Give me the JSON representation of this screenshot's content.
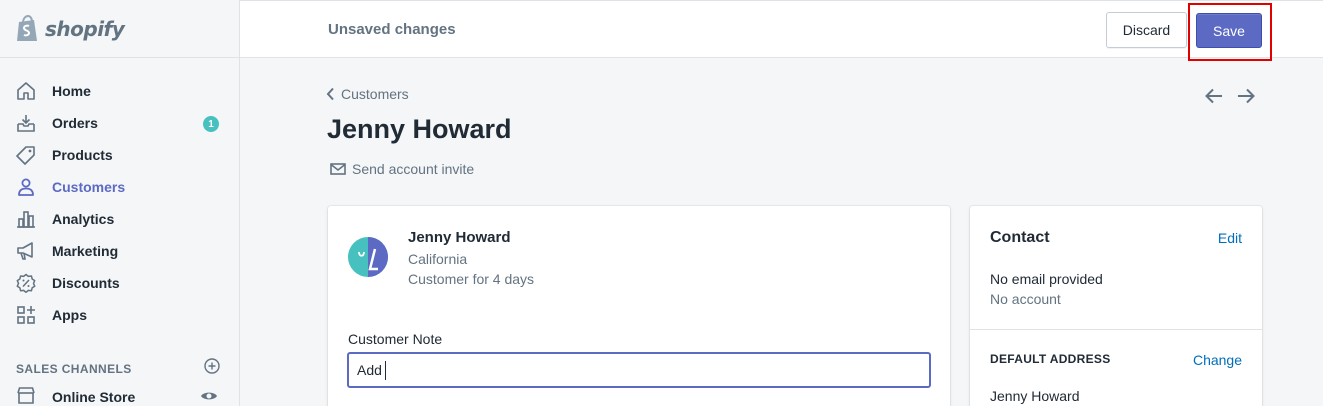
{
  "brand": {
    "name": "shopify",
    "icon": "shopify-bag-icon"
  },
  "sidebar": {
    "items": [
      {
        "label": "Home",
        "icon": "home-icon"
      },
      {
        "label": "Orders",
        "icon": "orders-icon",
        "badge": "1"
      },
      {
        "label": "Products",
        "icon": "tag-icon"
      },
      {
        "label": "Customers",
        "icon": "person-icon",
        "active": true
      },
      {
        "label": "Analytics",
        "icon": "bar-chart-icon"
      },
      {
        "label": "Marketing",
        "icon": "megaphone-icon"
      },
      {
        "label": "Discounts",
        "icon": "discount-icon"
      },
      {
        "label": "Apps",
        "icon": "apps-icon"
      }
    ],
    "sales_channels": {
      "heading": "SALES CHANNELS",
      "items": [
        {
          "label": "Online Store"
        }
      ]
    }
  },
  "topbar": {
    "status": "Unsaved changes",
    "discard_label": "Discard",
    "save_label": "Save"
  },
  "page": {
    "breadcrumb": "Customers",
    "title": "Jenny Howard",
    "invite_label": "Send account invite"
  },
  "customer": {
    "name": "Jenny Howard",
    "location": "California",
    "since": "Customer for 4 days",
    "note_label": "Customer Note",
    "note_value": "Add"
  },
  "contact": {
    "title": "Contact",
    "edit_label": "Edit",
    "email_text": "No email provided",
    "account_text": "No account",
    "address_heading": "DEFAULT ADDRESS",
    "change_label": "Change",
    "address_name": "Jenny Howard"
  },
  "colors": {
    "accent": "#5c6ac4",
    "link": "#006fbb",
    "badge": "#47c1bf",
    "highlight": "#e00000"
  }
}
